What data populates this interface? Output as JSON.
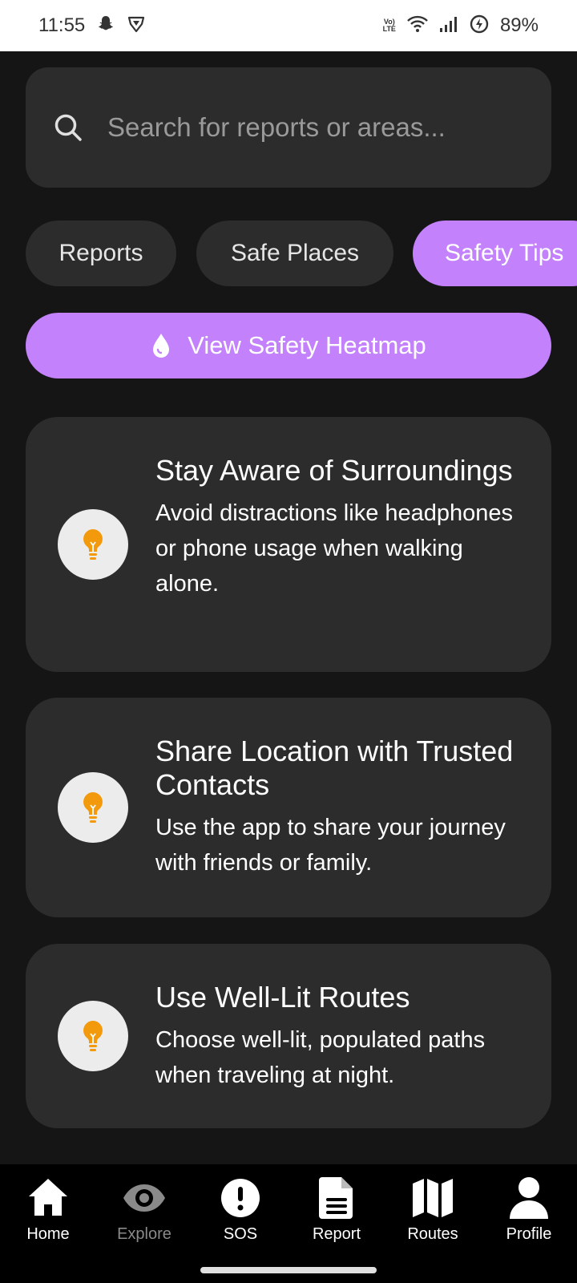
{
  "status_bar": {
    "time": "11:55",
    "lte_top": "Vo)",
    "lte_bottom": "LTE",
    "battery": "89%"
  },
  "search": {
    "placeholder": "Search for reports or areas..."
  },
  "tabs": [
    {
      "label": "Reports",
      "active": false
    },
    {
      "label": "Safe Places",
      "active": false
    },
    {
      "label": "Safety Tips",
      "active": true
    }
  ],
  "heatmap_button": {
    "label": "View Safety Heatmap"
  },
  "tips": [
    {
      "title": "Stay Aware of Surroundings",
      "description": "Avoid distractions like headphones or phone usage when walking alone."
    },
    {
      "title": "Share Location with Trusted Contacts",
      "description": "Use the app to share your journey with friends or family."
    },
    {
      "title": "Use Well-Lit Routes",
      "description": "Choose well-lit, populated paths when traveling at night."
    }
  ],
  "nav": [
    {
      "label": "Home",
      "icon": "home-icon"
    },
    {
      "label": "Explore",
      "icon": "eye-icon"
    },
    {
      "label": "SOS",
      "icon": "alert-icon"
    },
    {
      "label": "Report",
      "icon": "document-icon"
    },
    {
      "label": "Routes",
      "icon": "map-icon"
    },
    {
      "label": "Profile",
      "icon": "user-icon"
    }
  ],
  "colors": {
    "accent": "#c381fb",
    "card": "#2c2c2c",
    "background": "#151515",
    "bulb": "#f39a0c"
  }
}
